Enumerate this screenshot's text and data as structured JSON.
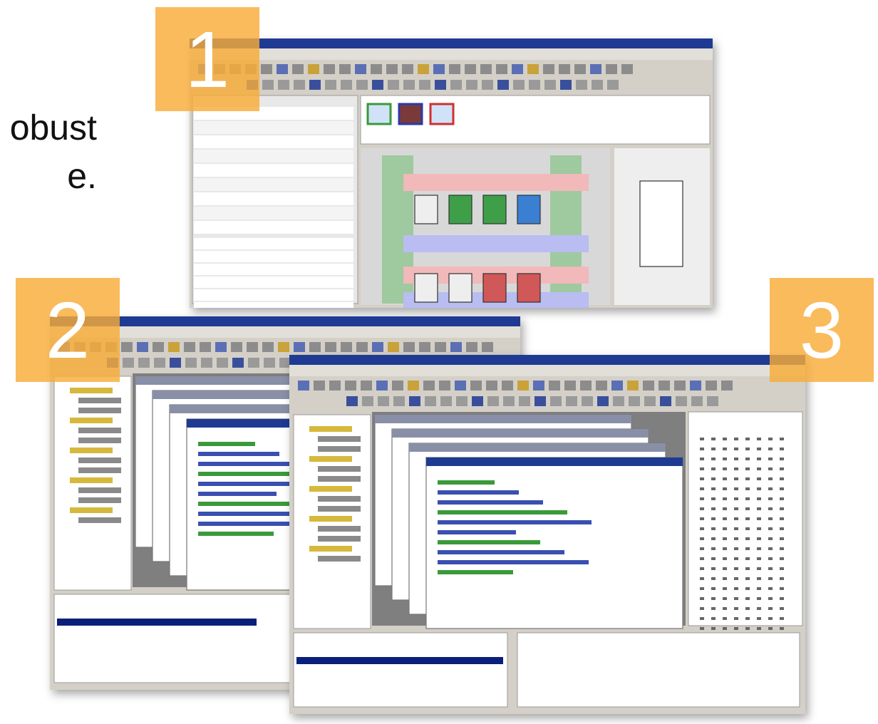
{
  "slide_text": [
    "obust",
    "e."
  ],
  "screenshots": [
    {
      "kind": "device-editor",
      "badge": "1"
    },
    {
      "kind": "code-editor",
      "badge": "2"
    },
    {
      "kind": "debugger",
      "badge": "3"
    }
  ]
}
